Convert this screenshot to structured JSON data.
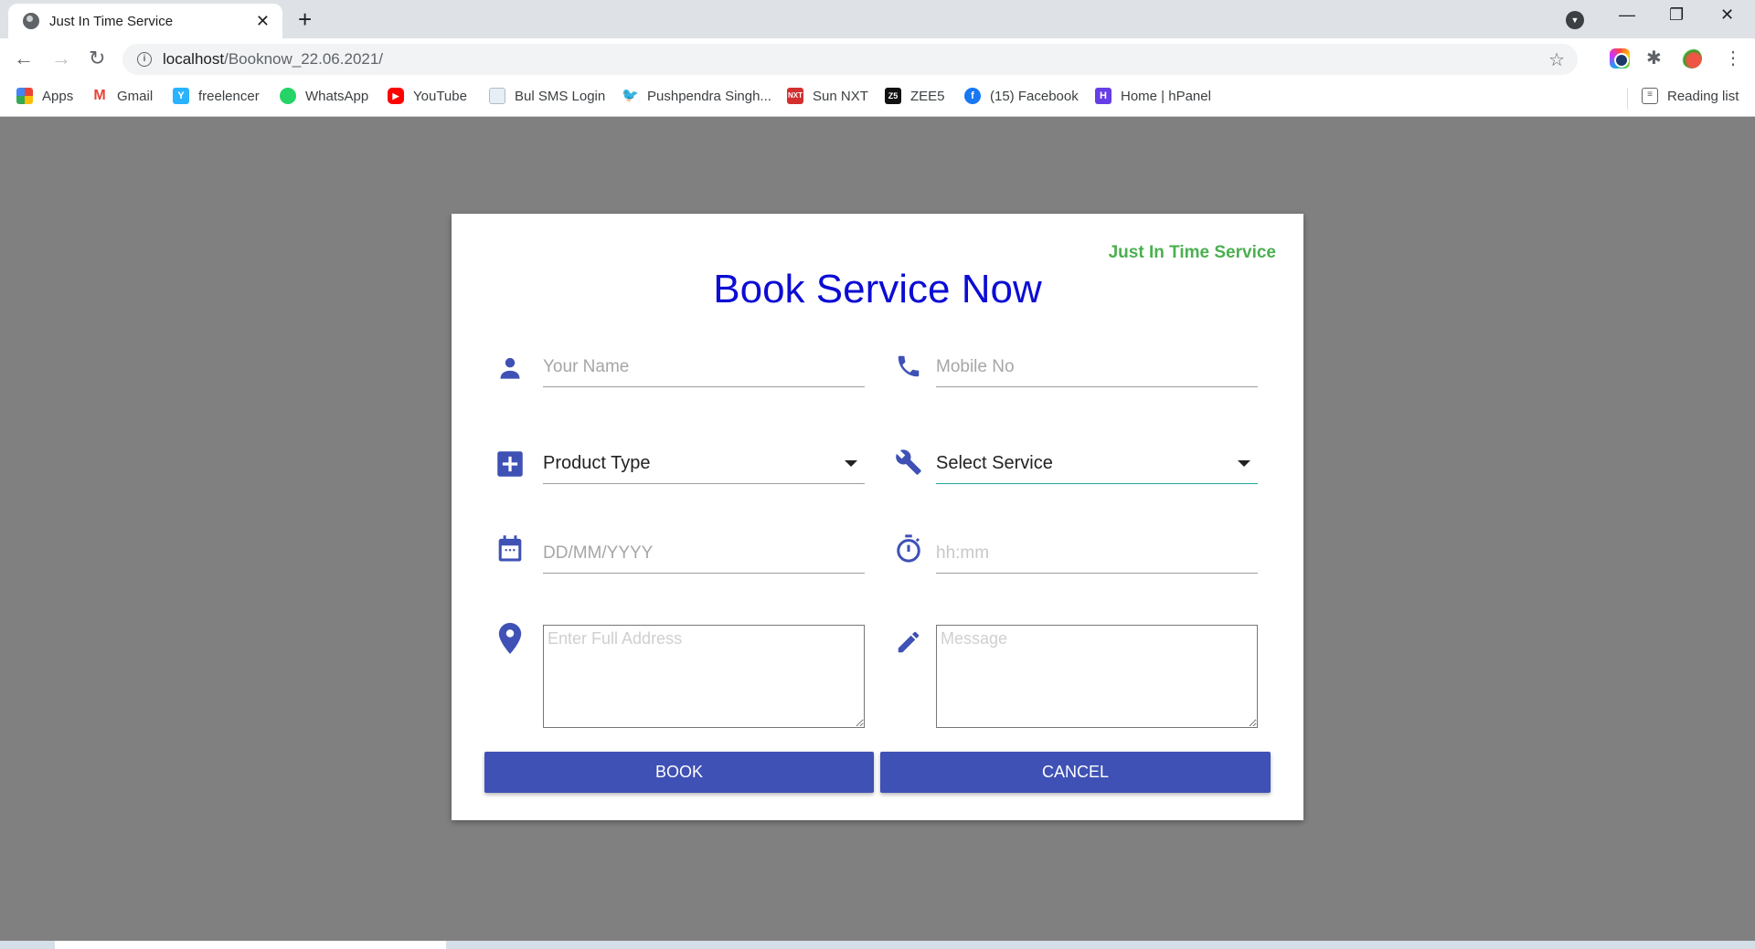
{
  "browser": {
    "tab_title": "Just In Time Service",
    "tab_close": "✕",
    "new_tab": "+",
    "url_host": "localhost",
    "url_path": "/Booknow_22.06.2021/",
    "bookmarks": [
      {
        "label": "Apps",
        "icon": "apps-grid-icon"
      },
      {
        "label": "Gmail",
        "icon": "gmail-icon"
      },
      {
        "label": "freelencer",
        "icon": "freelancer-icon"
      },
      {
        "label": "WhatsApp",
        "icon": "whatsapp-icon"
      },
      {
        "label": "YouTube",
        "icon": "youtube-icon"
      },
      {
        "label": "Bul SMS Login",
        "icon": "document-icon"
      },
      {
        "label": "Pushpendra Singh...",
        "icon": "twitter-icon"
      },
      {
        "label": "Sun NXT",
        "icon": "sunnxt-icon"
      },
      {
        "label": "ZEE5",
        "icon": "zee5-icon"
      },
      {
        "label": "(15) Facebook",
        "icon": "facebook-icon"
      },
      {
        "label": "Home | hPanel",
        "icon": "hostinger-icon"
      }
    ],
    "reading_list": "Reading list"
  },
  "page": {
    "brand": "Just In Time Service",
    "title": "Book Service Now",
    "colors": {
      "brand_green": "#4caf50",
      "title_blue": "#0c0cd4",
      "icon_indigo": "#3f51b5",
      "button_indigo": "#3f51b5",
      "focus_teal": "#26a69a"
    },
    "fields": {
      "name": {
        "placeholder": "Your Name",
        "value": ""
      },
      "mobile": {
        "placeholder": "Mobile No",
        "value": ""
      },
      "product_type": {
        "selected": "Product Type"
      },
      "service": {
        "selected": "Select Service"
      },
      "date": {
        "placeholder": "DD/MM/YYYY",
        "value": ""
      },
      "time": {
        "placeholder": "hh:mm",
        "value": ""
      },
      "address": {
        "placeholder": "Enter Full Address",
        "value": ""
      },
      "message": {
        "placeholder": "Message",
        "value": ""
      }
    },
    "buttons": {
      "book": "BOOK",
      "cancel": "CANCEL"
    }
  }
}
